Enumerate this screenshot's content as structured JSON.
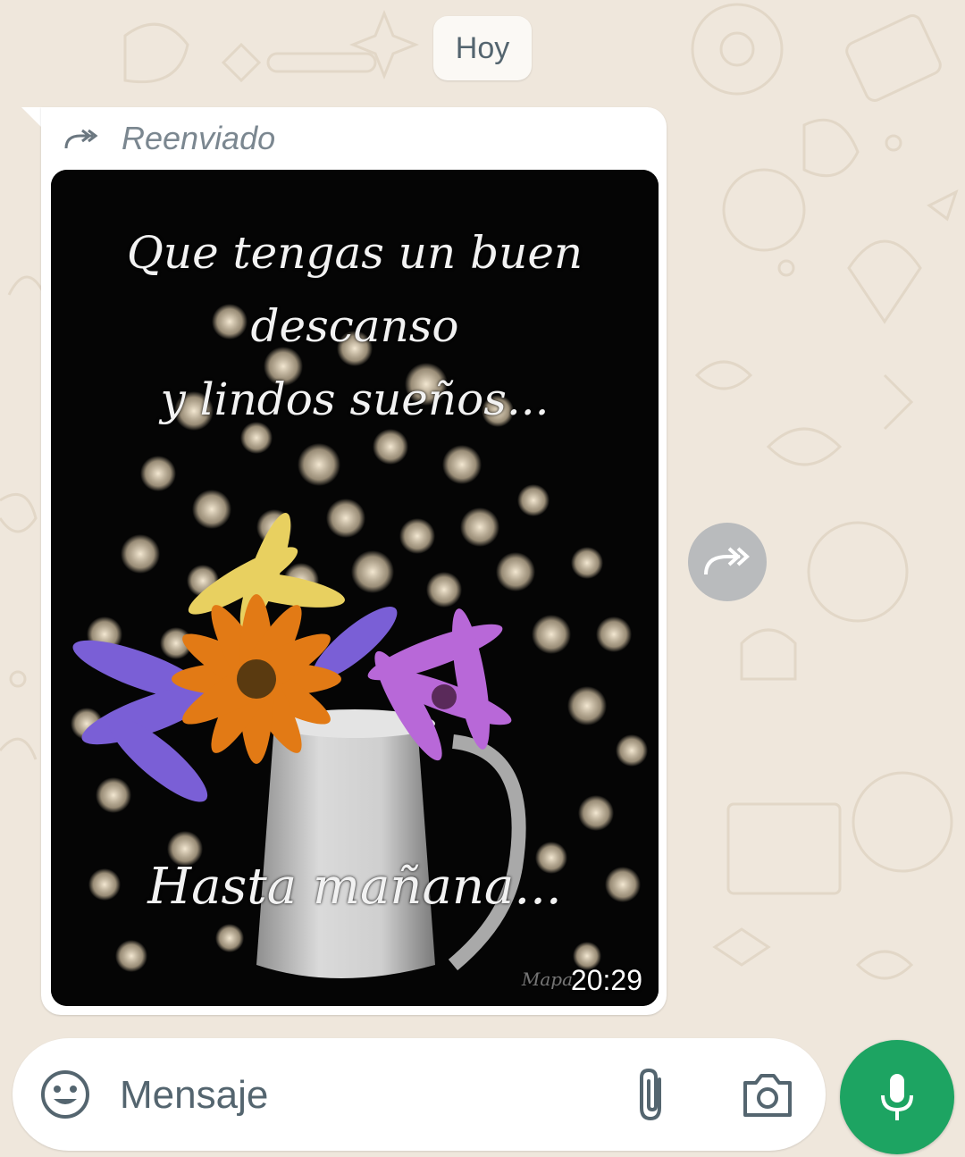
{
  "chat": {
    "date_separator": "Hoy"
  },
  "message": {
    "forwarded_label": "Reenviado",
    "image": {
      "caption_lines": [
        "Que tengas un buen",
        "descanso",
        "y lindos sueños..."
      ],
      "footer_caption": "Hasta mañana...",
      "watermark": "Mapa"
    },
    "time": "20:29"
  },
  "composer": {
    "placeholder": "Mensaje"
  },
  "icons": {
    "forwarded": "forward-double-arrow-icon",
    "share": "forward-share-icon",
    "emoji": "emoji-smile-icon",
    "attach": "paperclip-icon",
    "camera": "camera-icon",
    "mic": "microphone-icon"
  },
  "colors": {
    "wallpaper": "#efe7dc",
    "bubble": "#ffffff",
    "accent_green": "#1da462",
    "share_button": "#b9bbbd"
  }
}
